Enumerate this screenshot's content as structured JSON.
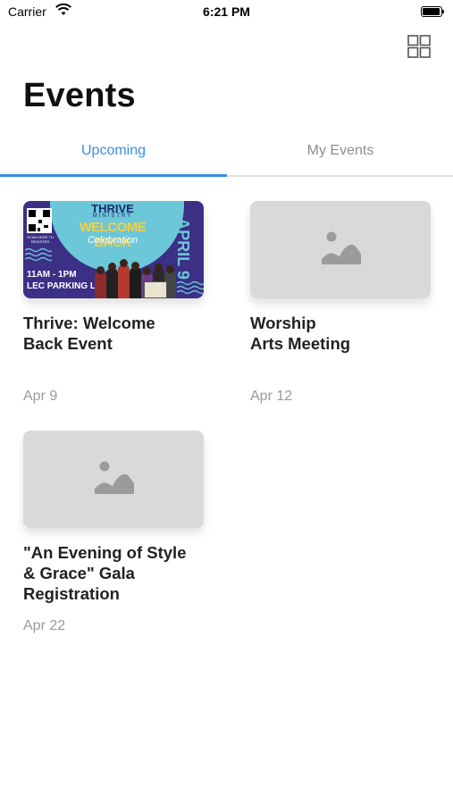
{
  "status_bar": {
    "carrier": "Carrier",
    "time": "6:21 PM"
  },
  "header": {
    "title": "Events",
    "grid_icon": "grid-view-icon"
  },
  "tabs": [
    {
      "label": "Upcoming",
      "active": true
    },
    {
      "label": "My Events",
      "active": false
    }
  ],
  "events": [
    {
      "title": "Thrive: Welcome\nBack Event",
      "date": "Apr 9",
      "image": {
        "brand": "THRIVE",
        "ministry": "MINISTRY",
        "headline": "WELCOME BACK",
        "script": "Celebration",
        "date_vertical": "APRIL 9",
        "time": "11AM - 1PM",
        "location": "LEC PARKING LOT",
        "scan_text": "SCAN HERE TO REGISTER"
      }
    },
    {
      "title": "Worship\nArts Meeting",
      "date": "Apr 12",
      "image": null
    },
    {
      "title": "\"An Evening of Style\n& Grace\" Gala\nRegistration",
      "date": "Apr 22",
      "image": null
    }
  ],
  "colors": {
    "accent": "#3a8ee6",
    "tab_inactive": "#8e8e93",
    "placeholder_bg": "#d9d9d9",
    "placeholder_icon": "#9b9b9b",
    "date_text": "#999999"
  }
}
